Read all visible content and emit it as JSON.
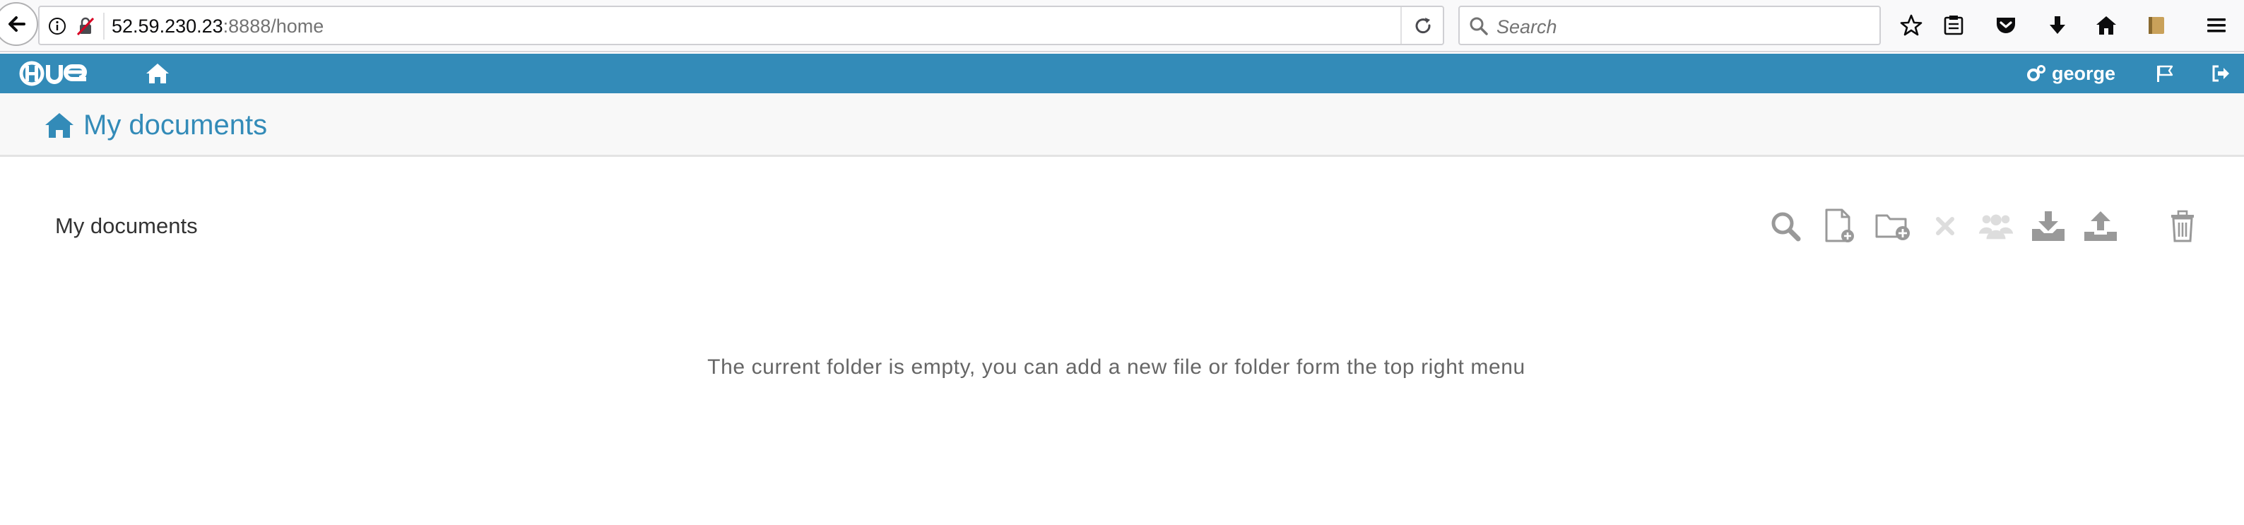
{
  "browser": {
    "url_host": "52.59.230.23",
    "url_rest": ":8888/home",
    "search_placeholder": "Search"
  },
  "hue": {
    "username": "george"
  },
  "page": {
    "header_title": "My documents",
    "section_title": "My documents",
    "empty_message": "The current folder is empty, you can add a new file or folder form the top right menu"
  },
  "colors": {
    "hue_blue": "#338bb8",
    "icon_gray": "#999999",
    "icon_disabled": "#dddddd"
  }
}
